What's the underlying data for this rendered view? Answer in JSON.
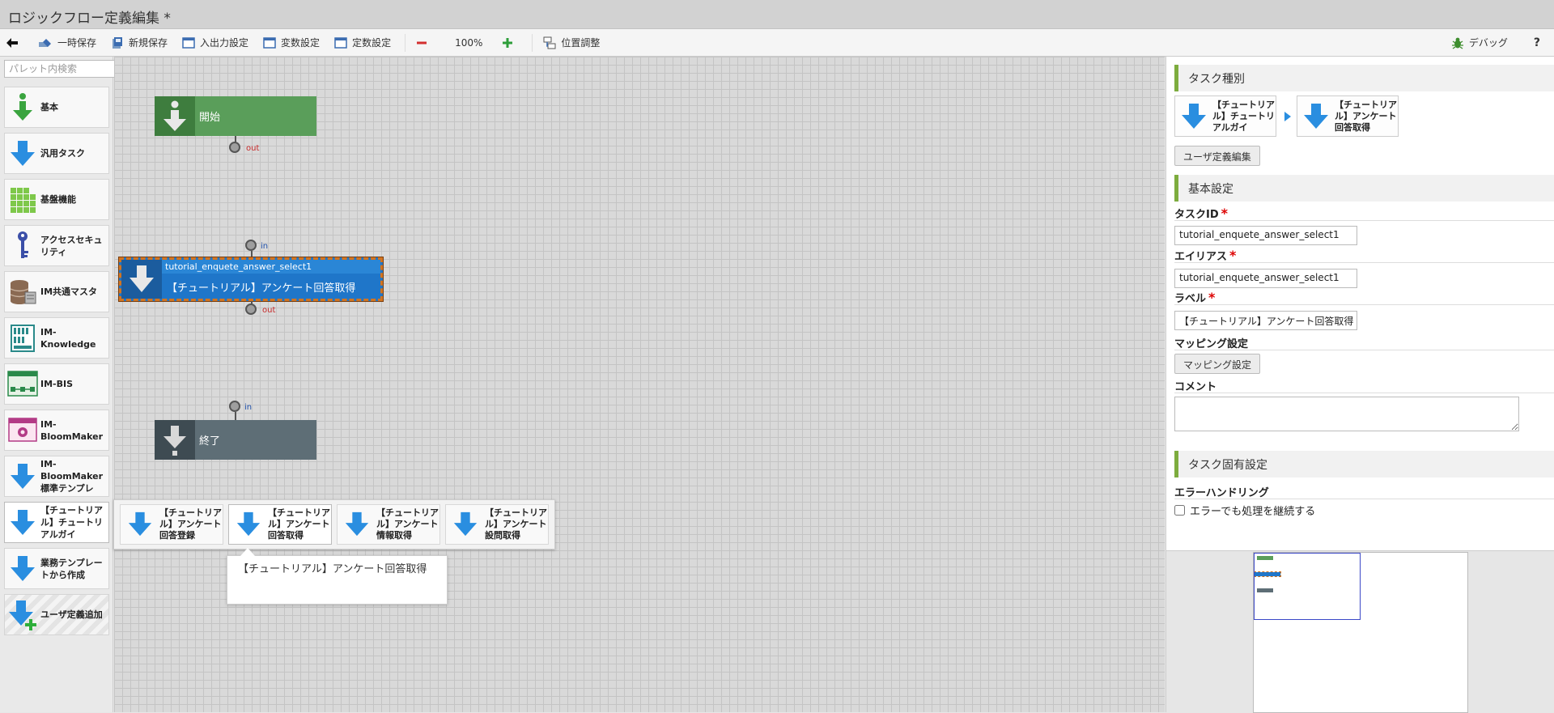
{
  "window": {
    "title": "ロジックフロー定義編集 *"
  },
  "toolbar": {
    "temp_save": "一時保存",
    "new_save": "新規保存",
    "io_settings": "入出力設定",
    "var_settings": "変数設定",
    "const_settings": "定数設定",
    "zoom": "100%",
    "arrange": "位置調整",
    "debug": "デバッグ",
    "help": "?"
  },
  "palette": {
    "search_placeholder": "パレット内検索",
    "items": [
      {
        "label": "基本"
      },
      {
        "label": "汎用タスク"
      },
      {
        "label": "基盤機能"
      },
      {
        "label": "アクセスセキュリティ"
      },
      {
        "label": "IM共通マスタ"
      },
      {
        "label": "IM-Knowledge"
      },
      {
        "label": "IM-BIS"
      },
      {
        "label": "IM-BloomMaker"
      },
      {
        "label": "IM-BloomMaker標準テンプレ"
      },
      {
        "label": "【チュートリアル】チュートリアルガイ"
      },
      {
        "label": "業務テンプレートから作成"
      },
      {
        "label": "ユーザ定義追加"
      }
    ]
  },
  "canvas": {
    "start_node": {
      "label": "開始",
      "out": "out"
    },
    "task_node": {
      "id": "tutorial_enquete_answer_select1",
      "label": "【チュートリアル】アンケート回答取得",
      "in": "in",
      "out": "out"
    },
    "end_node": {
      "label": "終了",
      "in": "in"
    }
  },
  "subpalette": {
    "items": [
      {
        "label": "【チュートリアル】アンケート回答登録"
      },
      {
        "label": "【チュートリアル】アンケート回答取得"
      },
      {
        "label": "【チュートリアル】アンケート情報取得"
      },
      {
        "label": "【チュートリアル】アンケート設問取得"
      }
    ],
    "tooltip": "【チュートリアル】アンケート回答取得"
  },
  "properties": {
    "task_type": {
      "header": "タスク種別",
      "path": [
        {
          "label": "【チュートリアル】チュートリアルガイ"
        },
        {
          "label": "【チュートリアル】アンケート回答取得"
        }
      ],
      "user_def_edit": "ユーザ定義編集"
    },
    "basic": {
      "header": "基本設定",
      "task_id_label": "タスクID",
      "task_id_value": "tutorial_enquete_answer_select1",
      "alias_label": "エイリアス",
      "alias_value": "tutorial_enquete_answer_select1",
      "label_label": "ラベル",
      "label_value": "【チュートリアル】アンケート回答取得",
      "mapping_label": "マッピング設定",
      "mapping_button": "マッピング設定",
      "comment_label": "コメント",
      "required_mark": "*"
    },
    "specific": {
      "header": "タスク固有設定",
      "error_label": "エラーハンドリング",
      "continue_checkbox": "エラーでも処理を継続する"
    }
  },
  "colors": {
    "start_green": "#5a9e5a",
    "task_blue": "#1f76c9",
    "end_gray": "#5e6e76",
    "selection_orange": "#d3741f",
    "section_accent": "#7dac3e"
  }
}
